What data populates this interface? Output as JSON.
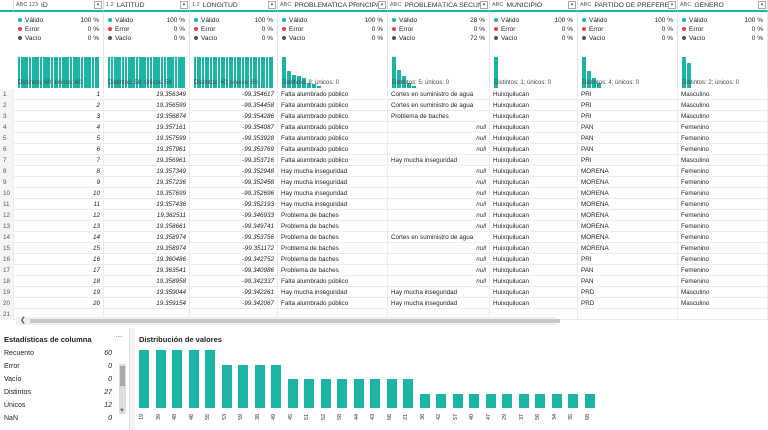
{
  "colors": {
    "accent": "#1ab5a5",
    "valid": "#1ab5a5",
    "error": "#e04050",
    "empty": "#555555"
  },
  "columns": [
    {
      "type": "ABC 123",
      "label": "ID",
      "valid": "100 %",
      "error": "0 %",
      "empty": "0 %",
      "distinct": "Distintos: 60; únicos: 60"
    },
    {
      "type": "1.2",
      "label": "LATITUD",
      "valid": "100 %",
      "error": "0 %",
      "empty": "0 %",
      "distinct": "Distintos: 58; únicos: 56"
    },
    {
      "type": "1.2",
      "label": "LONGITUD",
      "valid": "100 %",
      "error": "0 %",
      "empty": "0 %",
      "distinct": "Distintos: 60; únicos: 60"
    },
    {
      "type": "ABC",
      "label": "PROBLEMATICA PRINCIPAL",
      "valid": "100 %",
      "error": "0 %",
      "empty": "0 %",
      "distinct": "Distintos: 8; únicos: 0"
    },
    {
      "type": "ABC",
      "label": "PROBLEMÁTICA SECUNDA...",
      "valid": "28 %",
      "error": "0 %",
      "empty": "72 %",
      "distinct": "Distintos: 5; únicos: 0"
    },
    {
      "type": "ABC",
      "label": "MUNICIPIO",
      "valid": "100 %",
      "error": "0 %",
      "empty": "0 %",
      "distinct": "Distintos: 1; únicos: 0"
    },
    {
      "type": "ABC",
      "label": "PARTIDO DE PREFERENCIA",
      "valid": "100 %",
      "error": "0 %",
      "empty": "0 %",
      "distinct": "Distintos: 4; únicos: 0"
    },
    {
      "type": "ABC",
      "label": "GENERO",
      "valid": "100 %",
      "error": "0 %",
      "empty": "0 %",
      "distinct": "Distintos: 2; únicos: 0"
    }
  ],
  "quality_labels": {
    "valid": "Válido",
    "error": "Error",
    "empty": "Vacío"
  },
  "null_text": "null",
  "rows": [
    [
      "1",
      "1",
      "19.356349",
      "-99.354617",
      "Falta alumbrado público",
      "Cortes en suministro de agua",
      "Huixquilucan",
      "PRI",
      "Masculino"
    ],
    [
      "2",
      "2",
      "19.356599",
      "-99.354458",
      "Falta alumbrado público",
      "Cortes en suministro de agua",
      "Huixquilucan",
      "PRI",
      "Masculino"
    ],
    [
      "3",
      "3",
      "19.356874",
      "-99.354286",
      "Falta alumbrado público",
      "Problema de baches",
      "Huixquilucan",
      "PRI",
      "Masculino"
    ],
    [
      "4",
      "4",
      "19.357161",
      "-99.354087",
      "Falta alumbrado público",
      "null",
      "Huixquilucan",
      "PAN",
      "Femenino"
    ],
    [
      "5",
      "5",
      "19.357599",
      "-99.353928",
      "Falta alumbrado público",
      "null",
      "Huixquilucan",
      "PAN",
      "Femenino"
    ],
    [
      "6",
      "6",
      "19.357961",
      "-99.353769",
      "Falta alumbrado público",
      "null",
      "Huixquilucan",
      "PAN",
      "Femenino"
    ],
    [
      "7",
      "7",
      "19.356961",
      "-99.353716",
      "Falta alumbrado público",
      "Hay mucha inseguridad",
      "Huixquilucan",
      "PRI",
      "Masculino"
    ],
    [
      "8",
      "8",
      "19.357349",
      "-99.352948",
      "Hay mucha inseguridad",
      "null",
      "Huixquilucan",
      "MORENA",
      "Femenino"
    ],
    [
      "9",
      "9",
      "19.357236",
      "-99.352458",
      "Hay mucha inseguridad",
      "null",
      "Huixquilucan",
      "MORENA",
      "Femenino"
    ],
    [
      "10",
      "10",
      "19.357699",
      "-99.352696",
      "Hay mucha inseguridad",
      "null",
      "Huixquilucan",
      "MORENA",
      "Femenino"
    ],
    [
      "11",
      "11",
      "19.357436",
      "-99.352193",
      "Hay mucha inseguridad",
      "null",
      "Huixquilucan",
      "MORENA",
      "Femenino"
    ],
    [
      "12",
      "12",
      "19.362511",
      "-99.346933",
      "Problema de baches",
      "null",
      "Huixquilucan",
      "MORENA",
      "Femenino"
    ],
    [
      "13",
      "13",
      "19.358661",
      "-99.349741",
      "Problema de baches",
      "null",
      "Huixquilucan",
      "MORENA",
      "Femenino"
    ],
    [
      "14",
      "14",
      "19.358974",
      "-99.353756",
      "Problema de baches",
      "Cortes en suministro de agua",
      "Huixquilucan",
      "MORENA",
      "Femenino"
    ],
    [
      "15",
      "15",
      "19.358974",
      "-99.351172",
      "Problema de baches",
      "null",
      "Huixquilucan",
      "MORENA",
      "Femenino"
    ],
    [
      "16",
      "16",
      "19.360486",
      "-99.342752",
      "Problema de baches",
      "null",
      "Huixquilucan",
      "PRI",
      "Femenino"
    ],
    [
      "17",
      "17",
      "19.363541",
      "-99.340986",
      "Problema de baches",
      "null",
      "Huixquilucan",
      "PAN",
      "Femenino"
    ],
    [
      "18",
      "18",
      "19.358958",
      "-99.342337",
      "Falta alumbrado público",
      "null",
      "Huixquilucan",
      "PAN",
      "Femenino"
    ],
    [
      "19",
      "19",
      "19.359044",
      "-99.342261",
      "Hay mucha inseguridad",
      "Hay mucha inseguridad",
      "Huixquilucan",
      "PRD",
      "Masculino"
    ],
    [
      "20",
      "20",
      "19.359154",
      "-99.342067",
      "Falta alumbrado público",
      "Hay mucha inseguridad",
      "Huixquilucan",
      "PRD",
      "Masculino"
    ],
    [
      "21",
      "",
      "",
      "",
      "",
      "",
      "",
      "",
      ""
    ]
  ],
  "stats": {
    "title": "Estadísticas de columna",
    "more": "···",
    "items": [
      {
        "label": "Recuento",
        "value": "60"
      },
      {
        "label": "Error",
        "value": "0"
      },
      {
        "label": "Vacío",
        "value": "0"
      },
      {
        "label": "Distintos",
        "value": "27"
      },
      {
        "label": "Únicos",
        "value": "12"
      },
      {
        "label": "NaN",
        "value": "0"
      }
    ]
  },
  "chart_data": {
    "type": "bar",
    "title": "Distribución de valores",
    "categories": [
      "19",
      "39",
      "48",
      "46",
      "55",
      "53",
      "59",
      "38",
      "49",
      "45",
      "51",
      "52",
      "58",
      "44",
      "43",
      "66",
      "21",
      "36",
      "42",
      "57",
      "40",
      "47",
      "29",
      "37",
      "56",
      "34",
      "35",
      "68"
    ],
    "values": [
      4,
      4,
      4,
      4,
      4,
      3,
      3,
      3,
      3,
      2,
      2,
      2,
      2,
      2,
      2,
      2,
      2,
      1,
      1,
      1,
      1,
      1,
      1,
      1,
      1,
      1,
      1,
      1
    ],
    "ylim": [
      0,
      4
    ]
  }
}
